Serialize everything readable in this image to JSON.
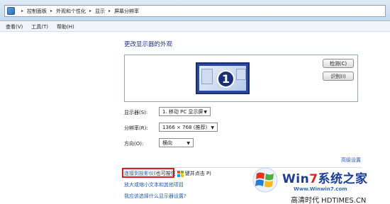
{
  "breadcrumb": {
    "items": [
      "控制面板",
      "外观和个性化",
      "显示",
      "屏幕分辨率"
    ],
    "separator": "▸"
  },
  "menu": {
    "items": [
      "查看(V)",
      "工具(T)",
      "帮助(H)"
    ]
  },
  "page_title": "更改显示器的外观",
  "monitor": {
    "number": "1"
  },
  "buttons": {
    "detect": "检测(C)",
    "identify": "识别(I)"
  },
  "form": {
    "display_label": "显示器(S):",
    "display_value": "1. 移动 PC 显示屏",
    "resolution_label": "分辨率(R):",
    "resolution_value": "1366 × 768 (推荐)",
    "orientation_label": "方向(O):",
    "orientation_value": "横向"
  },
  "advanced_link": "高级设置",
  "connect": {
    "link": "连接到投影仪",
    "text_before": "(也可按住",
    "text_after": "键并点击 P)"
  },
  "links": {
    "text_size": "放大或缩小文本和其他项目",
    "which_settings": "我应该选择什么显示器设置?"
  },
  "watermark": {
    "brand_prefix": "Win",
    "brand_seven": "7",
    "brand_suffix": "系统之家",
    "url": "Www.Winwin7.com",
    "footer": "高清时代 HDTIMES.CN"
  },
  "colors": {
    "link": "#1f5bb8",
    "title": "#1e3287",
    "highlight": "#e01b1b",
    "monitor": "#2a4b9c"
  },
  "icons": [
    "control-panel-icon",
    "chevron-down-icon",
    "windows-key-icon",
    "windows-logo-icon"
  ]
}
